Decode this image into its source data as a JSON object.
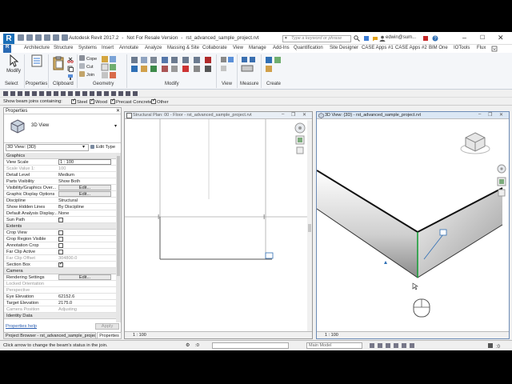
{
  "window": {
    "app_title": "Autodesk Revit 2017.2",
    "version_note": "Not For Resale Version",
    "separator": "-",
    "file_name": "rst_advanced_sample_project.rvt",
    "search_placeholder": "Type a keyword or phrase",
    "user": "edwin@sum..."
  },
  "tabs": [
    "Architecture",
    "Structure",
    "Systems",
    "Insert",
    "Annotate",
    "Analyze",
    "Massing & Site",
    "Collaborate",
    "View",
    "Manage",
    "Add-Ins",
    "Quantification",
    "Site Designer",
    "CASE Apps #1",
    "CASE Apps #2",
    "BIM One",
    "IOTools",
    "Flux"
  ],
  "file_tab": "R",
  "active_tab": "Modify",
  "ribbon": {
    "modify_label": "Modify",
    "select_label": "Select",
    "properties_label": "Properties",
    "clipboard_label": "Clipboard",
    "geometry_label": "Geometry",
    "modify_group_label": "Modify",
    "view_label": "View",
    "measure_label": "Measure",
    "create_label": "Create",
    "cope": "Cope",
    "cut": "Cut",
    "join": "Join"
  },
  "optbar": {
    "show_beam_joins": "Show beam joins containing:",
    "steel": "Steel",
    "wood": "Wood",
    "precast": "Precast Concrete",
    "other": "Other"
  },
  "properties": {
    "title": "Properties",
    "type_name": "3D View",
    "selector": "3D View: {3D}",
    "edit_type": "Edit Type",
    "rows": [
      {
        "kind": "cat",
        "k": "Graphics"
      },
      {
        "k": "View Scale",
        "v": "1 : 100",
        "style": "box"
      },
      {
        "k": "Scale Value    1:",
        "v": "100",
        "grey": true
      },
      {
        "k": "Detail Level",
        "v": "Medium"
      },
      {
        "k": "Parts Visibility",
        "v": "Show Both"
      },
      {
        "k": "Visibility/Graphics Over...",
        "v": "Edit...",
        "style": "btn"
      },
      {
        "k": "Graphic Display Options",
        "v": "Edit...",
        "style": "btn"
      },
      {
        "k": "Discipline",
        "v": "Structural"
      },
      {
        "k": "Show Hidden Lines",
        "v": "By Discipline"
      },
      {
        "k": "Default Analysis Display...",
        "v": "None"
      },
      {
        "k": "Sun Path",
        "v": "",
        "check": false
      },
      {
        "kind": "cat",
        "k": "Extents"
      },
      {
        "k": "Crop View",
        "v": "",
        "check": false
      },
      {
        "k": "Crop Region Visible",
        "v": "",
        "check": false
      },
      {
        "k": "Annotation Crop",
        "v": "",
        "check": false
      },
      {
        "k": "Far Clip Active",
        "v": "",
        "check": false
      },
      {
        "k": "Far Clip Offset",
        "v": "304800.0",
        "grey": true
      },
      {
        "k": "Section Box",
        "v": "",
        "check": true
      },
      {
        "kind": "cat",
        "k": "Camera"
      },
      {
        "k": "Rendering Settings",
        "v": "Edit...",
        "style": "btn"
      },
      {
        "k": "Locked Orientation",
        "v": "",
        "grey": true
      },
      {
        "k": "Perspective",
        "v": "",
        "grey": true
      },
      {
        "k": "Eye Elevation",
        "v": "62152.6"
      },
      {
        "k": "Target Elevation",
        "v": "2175.0"
      },
      {
        "k": "Camera Position",
        "v": "Adjusting",
        "grey": true
      },
      {
        "kind": "cat",
        "k": "Identity Data"
      }
    ],
    "help_link": "Properties help",
    "apply": "Apply"
  },
  "bottom_tabs": {
    "project_browser": "Project Browser - rst_advanced_sample_project...",
    "properties": "Properties"
  },
  "plan_view": {
    "title": "Structural Plan: 00 - Floor - rst_advanced_sample_project.rvt",
    "scale": "1 : 100"
  },
  "view3d": {
    "title": "3D View: {3D} - rst_advanced_sample_project.rvt",
    "scale": "1 : 100"
  },
  "status": {
    "message": "Click arrow to change the beam's status in the join.",
    "zero": ":0",
    "model": "Main Model"
  },
  "colors": {
    "accent": "#1b6fb7",
    "beam_join_marker": "#1a9e3a"
  }
}
